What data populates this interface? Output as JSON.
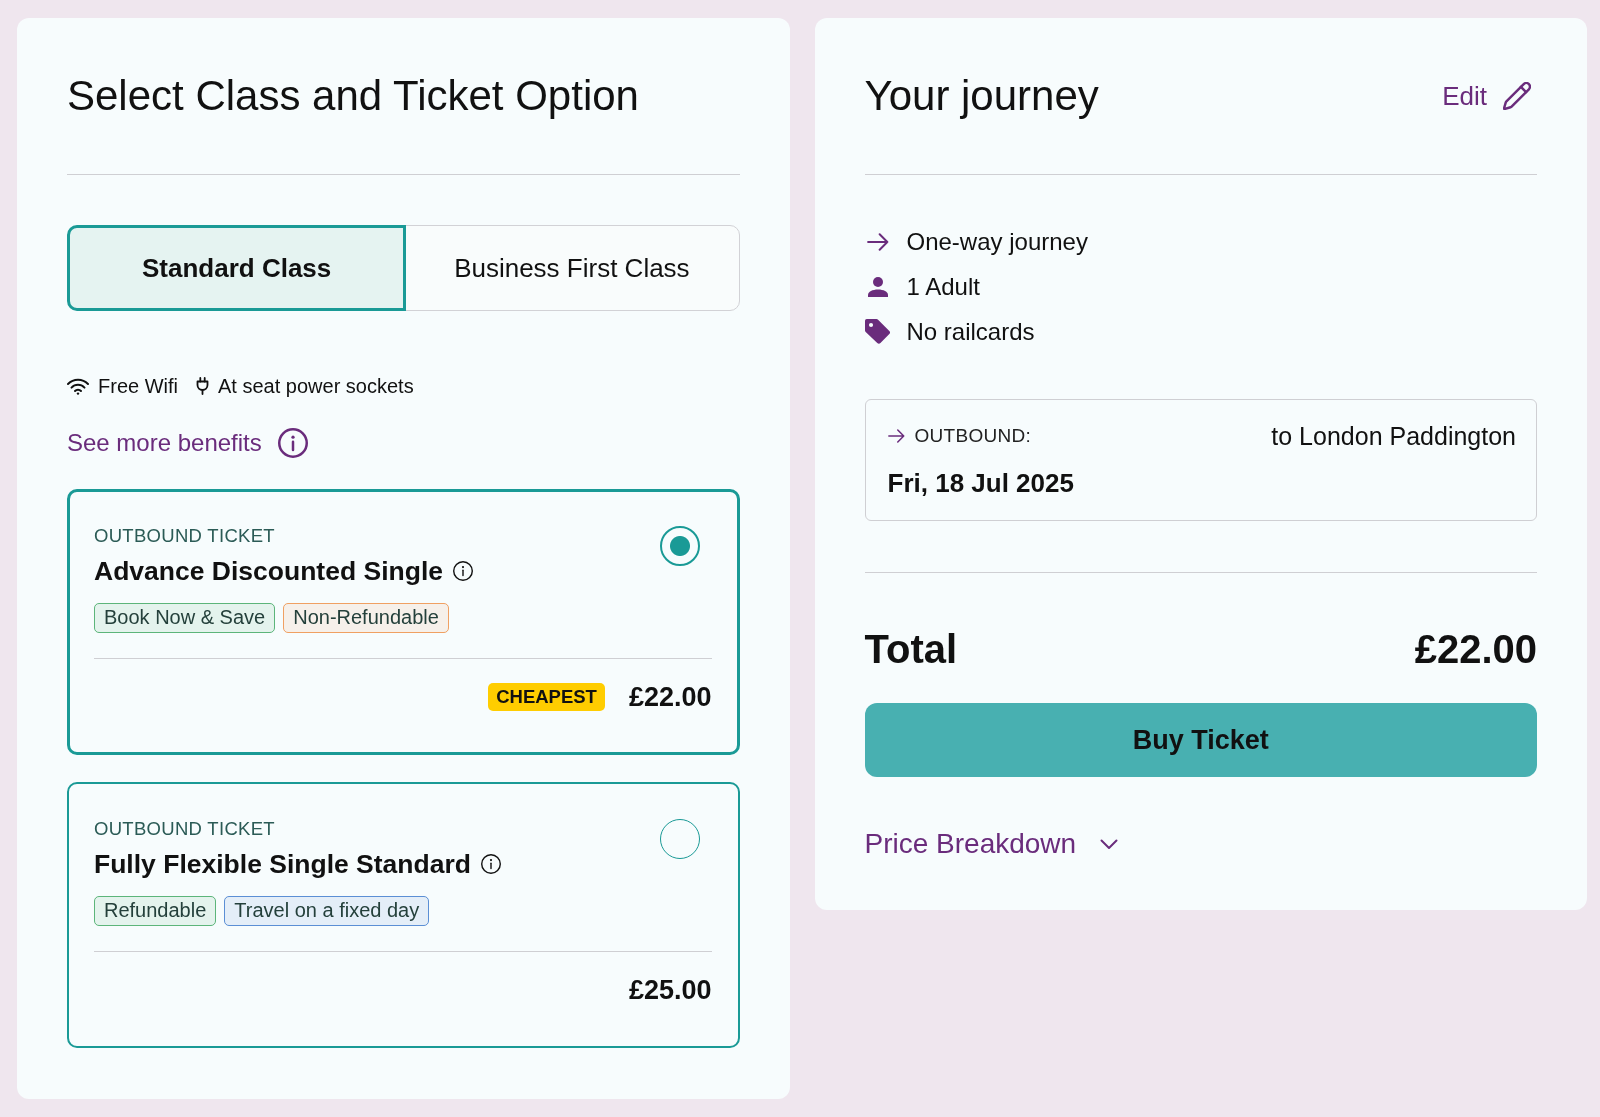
{
  "selection": {
    "title": "Select Class and Ticket Option",
    "class_tabs": [
      {
        "label": "Standard Class",
        "selected": true
      },
      {
        "label": "Business First Class",
        "selected": false
      }
    ],
    "benefits": [
      {
        "kind": "wifi",
        "label": "Free Wifi"
      },
      {
        "kind": "power",
        "label": "At seat power sockets"
      }
    ],
    "more_benefits": "See more benefits",
    "tickets": [
      {
        "direction": "OUTBOUND TICKET",
        "name": "Advance Discounted Single",
        "selected": true,
        "tags": [
          {
            "label": "Book Now & Save",
            "color": "#5cb57a"
          },
          {
            "label": "Non-Refundable",
            "color": "#f0a062"
          }
        ],
        "badge": "CHEAPEST",
        "price": "£22.00"
      },
      {
        "direction": "OUTBOUND TICKET",
        "name": "Fully Flexible Single Standard",
        "selected": false,
        "tags": [
          {
            "label": "Refundable",
            "color": "#5cb57a"
          },
          {
            "label": "Travel on a fixed day",
            "color": "#5b8fd5"
          }
        ],
        "price": "£25.00"
      }
    ]
  },
  "journey": {
    "title": "Your journey",
    "edit": "Edit",
    "details": [
      {
        "kind": "direction",
        "label": "One-way journey"
      },
      {
        "kind": "passenger",
        "label": "1 Adult"
      },
      {
        "kind": "railcard",
        "label": "No railcards"
      }
    ],
    "outbound": {
      "label": "OUTBOUND:",
      "destination": "to London Paddington",
      "date": "Fri, 18 Jul 2025"
    },
    "total": {
      "label": "Total",
      "amount": "£22.00"
    },
    "buy_button": "Buy Ticket",
    "price_breakdown": {
      "label": "Price Breakdown",
      "expanded": false
    }
  }
}
